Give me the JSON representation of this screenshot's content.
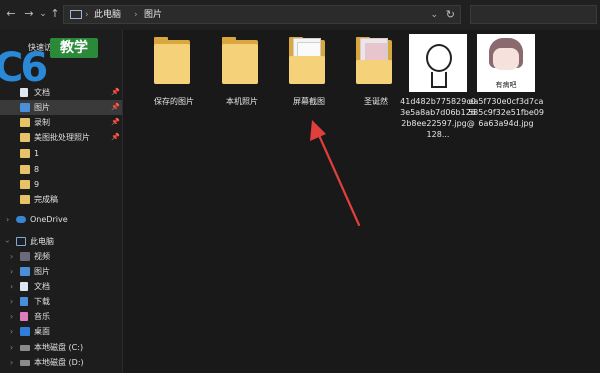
{
  "toolbar": {
    "back_glyph": "←",
    "forward_glyph": "→",
    "recent_glyph": "⌄",
    "up_glyph": "↑",
    "breadcrumb": [
      "此电脑",
      "图片"
    ],
    "sep": "›",
    "dropdown_glyph": "⌄",
    "refresh_glyph": "↻",
    "search_placeholder": ""
  },
  "logo": {
    "big": "C6",
    "badge": "教学"
  },
  "sidebar": {
    "quick_access_label": "快速访问",
    "items": [
      {
        "label": "文档",
        "icon": "doc"
      },
      {
        "label": "图片",
        "icon": "pic"
      },
      {
        "label": "录制",
        "icon": "folder"
      },
      {
        "label": "美图批处理照片",
        "icon": "folder"
      },
      {
        "label": "1",
        "icon": "folder"
      },
      {
        "label": "8",
        "icon": "folder"
      },
      {
        "label": "9",
        "icon": "folder"
      },
      {
        "label": "完成稿",
        "icon": "folder"
      }
    ],
    "onedrive": "OneDrive",
    "this_pc": "此电脑",
    "pc_items": [
      {
        "label": "视频",
        "icon": "video"
      },
      {
        "label": "图片",
        "icon": "pic"
      },
      {
        "label": "文档",
        "icon": "doc"
      },
      {
        "label": "下载",
        "icon": "dl"
      },
      {
        "label": "音乐",
        "icon": "music"
      },
      {
        "label": "桌面",
        "icon": "desk"
      },
      {
        "label": "本地磁盘 (C:)",
        "icon": "drive"
      },
      {
        "label": "本地磁盘 (D:)",
        "icon": "drive"
      }
    ],
    "pin_glyph": "📌",
    "chevron_glyph": "›"
  },
  "files": [
    {
      "name": "保存的图片",
      "type": "folder"
    },
    {
      "name": "本机照片",
      "type": "folder"
    },
    {
      "name": "屏幕截图",
      "type": "folder-papers"
    },
    {
      "name": "圣诞然",
      "type": "folder-papers"
    },
    {
      "name": "41d482b775829c03e5a8ab7d06b1262b8ee22597.jpg@128...",
      "type": "image"
    },
    {
      "name": "ea5f730e0cf3d7ca585c9f32e51fbe096a63a94d.jpg",
      "type": "image",
      "caption": "有病吧"
    }
  ],
  "colors": {
    "arrow": "#e0403c",
    "accent": "#2a89d6"
  }
}
